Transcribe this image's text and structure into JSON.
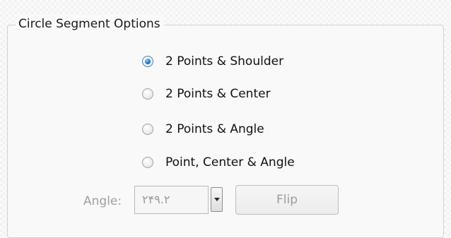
{
  "group": {
    "title": "Circle Segment Options"
  },
  "radios": [
    {
      "label": "2 Points & Shoulder",
      "checked": true
    },
    {
      "label": "2 Points & Center",
      "checked": false
    },
    {
      "label": "2 Points & Angle",
      "checked": false
    },
    {
      "label": "Point, Center & Angle",
      "checked": false
    }
  ],
  "angle": {
    "label": "Angle:",
    "value": "٢۴٩.٢",
    "enabled": false
  },
  "flip": {
    "label": "Flip",
    "enabled": false
  }
}
